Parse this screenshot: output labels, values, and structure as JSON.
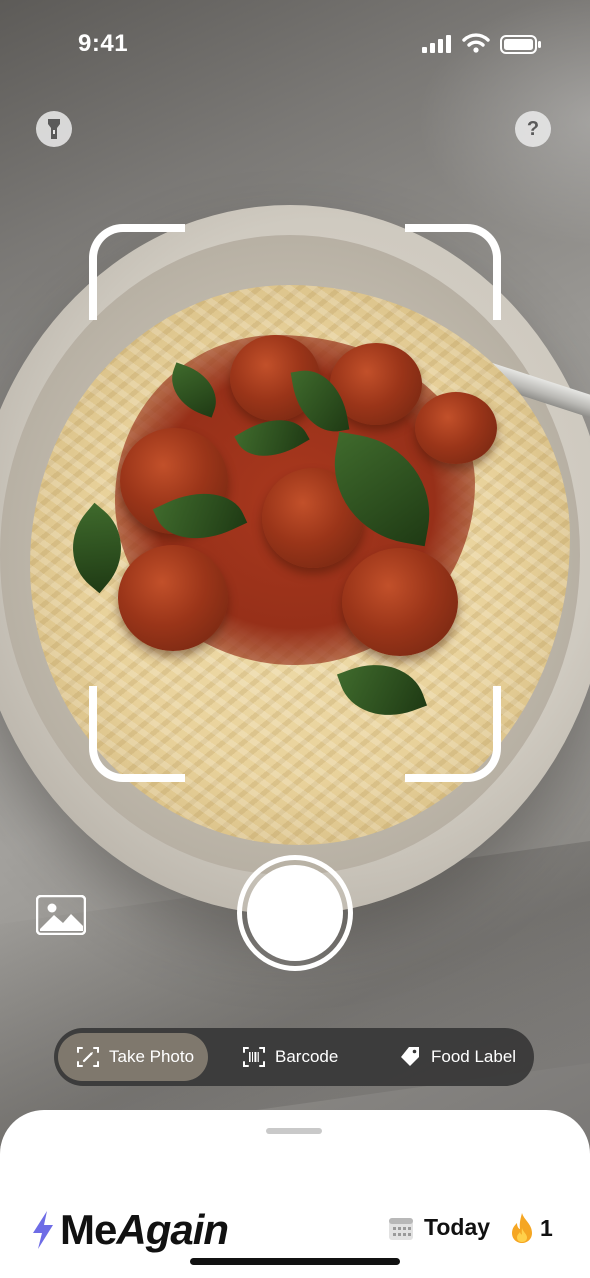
{
  "status_bar": {
    "time": "9:41"
  },
  "top_controls": {
    "flashlight_icon": "flashlight-icon",
    "help_glyph": "?"
  },
  "scanner": {
    "frame_icon": "scan-frame",
    "gallery_icon": "image-icon",
    "shutter_icon": "shutter-button"
  },
  "modes": [
    {
      "label": "Take Photo",
      "icon": "camera-scan-icon",
      "active": true
    },
    {
      "label": "Barcode",
      "icon": "barcode-icon",
      "active": false
    },
    {
      "label": "Food Label",
      "icon": "tag-icon",
      "active": false
    }
  ],
  "sheet": {
    "brand_prefix": "Me",
    "brand_suffix": "Again",
    "day_label": "Today",
    "streak_count": "1"
  },
  "colors": {
    "accent": "#6E6CE6",
    "flame": "#F5A623",
    "mode_bar_bg": "#373737"
  }
}
